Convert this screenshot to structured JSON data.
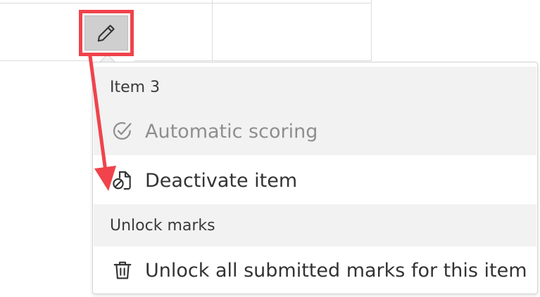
{
  "menu": {
    "section_item": "Item 3",
    "automatic_scoring": "Automatic scoring",
    "deactivate_item": "Deactivate item",
    "section_unlock": "Unlock marks",
    "unlock_all": "Unlock all submitted marks for this item"
  },
  "icons": {
    "edit": "pencil-icon",
    "automatic_scoring": "check-circle-icon",
    "deactivate": "document-block-icon",
    "unlock": "trash-icon"
  },
  "colors": {
    "annotation": "#f0434b",
    "section_bg": "#f2f2f2",
    "button_bg": "#cfcfcf"
  }
}
